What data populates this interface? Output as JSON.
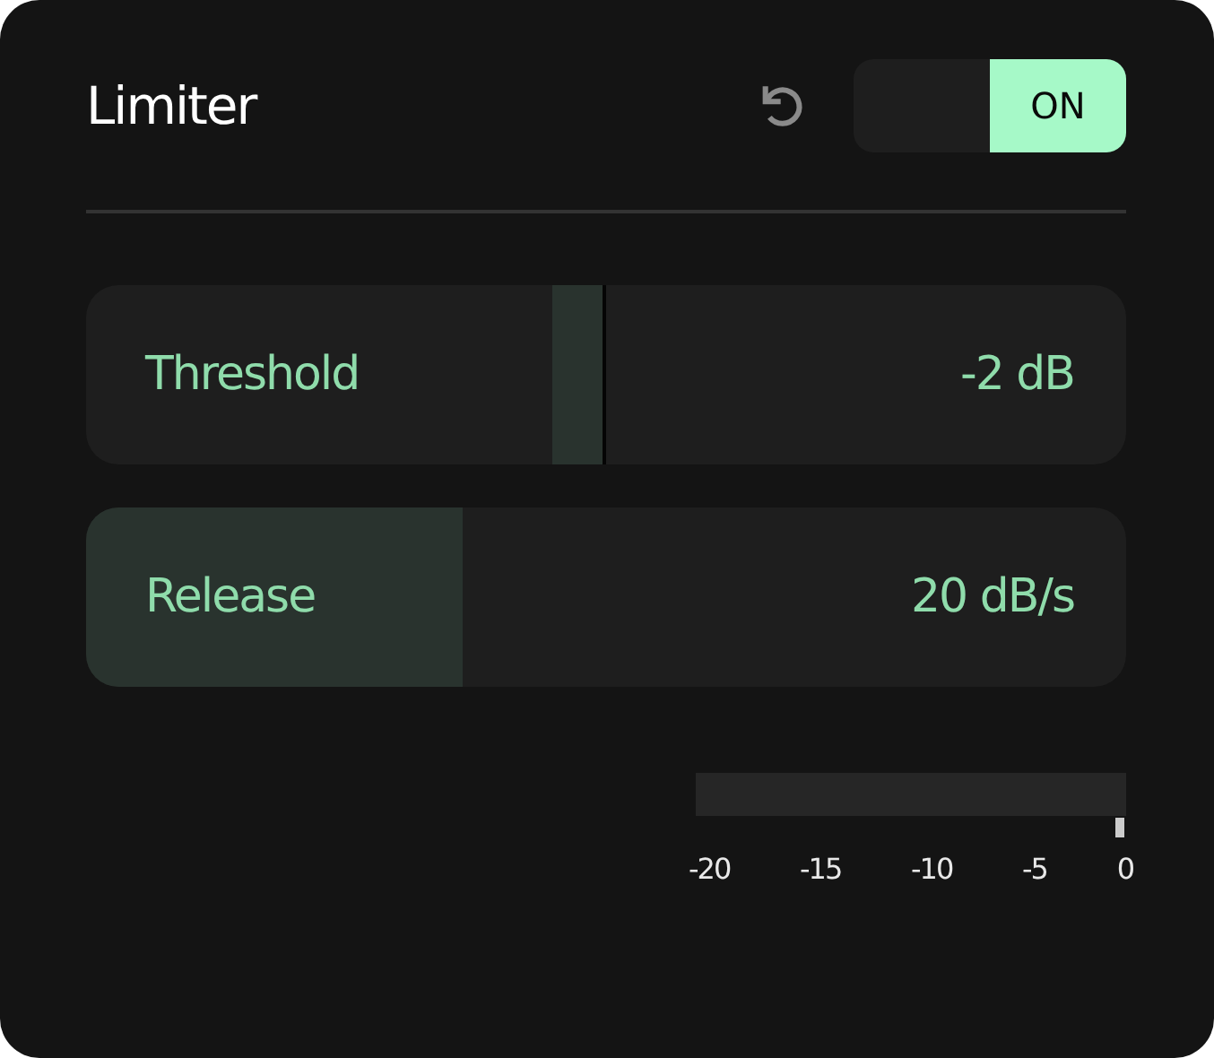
{
  "panel": {
    "title": "Limiter",
    "toggle": {
      "label": "ON",
      "on": true
    }
  },
  "sliders": [
    {
      "label": "Threshold",
      "value": "-2 dB",
      "level": 0.5,
      "kind": "marker"
    },
    {
      "label": "Release",
      "value": "20 dB/s",
      "level": 0.362,
      "kind": "fill"
    }
  ],
  "meter": {
    "ticks": [
      "-20",
      "-15",
      "-10",
      "-5",
      "0"
    ]
  }
}
